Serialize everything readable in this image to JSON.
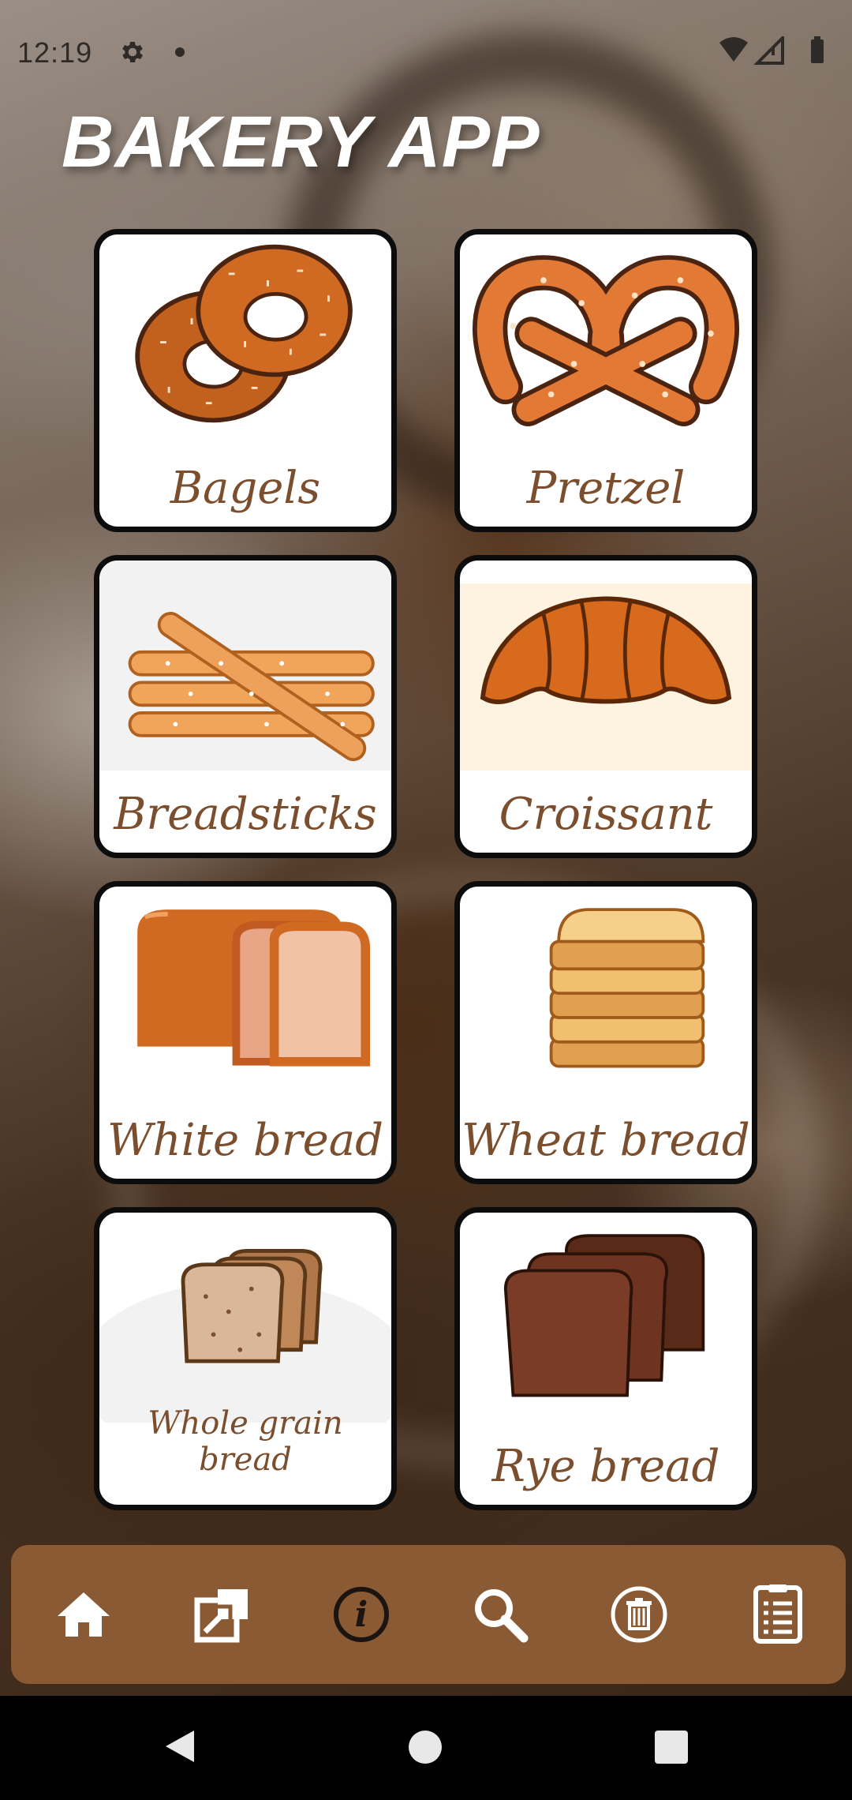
{
  "status_bar": {
    "time": "12:19"
  },
  "app": {
    "title": "BAKERY APP"
  },
  "items": [
    {
      "label": "Bagels"
    },
    {
      "label": "Pretzel"
    },
    {
      "label": "Breadsticks"
    },
    {
      "label": "Croissant"
    },
    {
      "label": "White bread"
    },
    {
      "label": "Wheat bread"
    },
    {
      "label": "Whole grain bread"
    },
    {
      "label": "Rye bread"
    }
  ],
  "bottom_nav": {
    "icons": [
      "home-icon",
      "open-external-icon",
      "info-icon",
      "search-icon",
      "delete-icon",
      "list-icon"
    ]
  },
  "colors": {
    "nav_bar": "#8a5a34",
    "label_text": "#7b4e2e",
    "tile_border": "#0c0c0c"
  }
}
